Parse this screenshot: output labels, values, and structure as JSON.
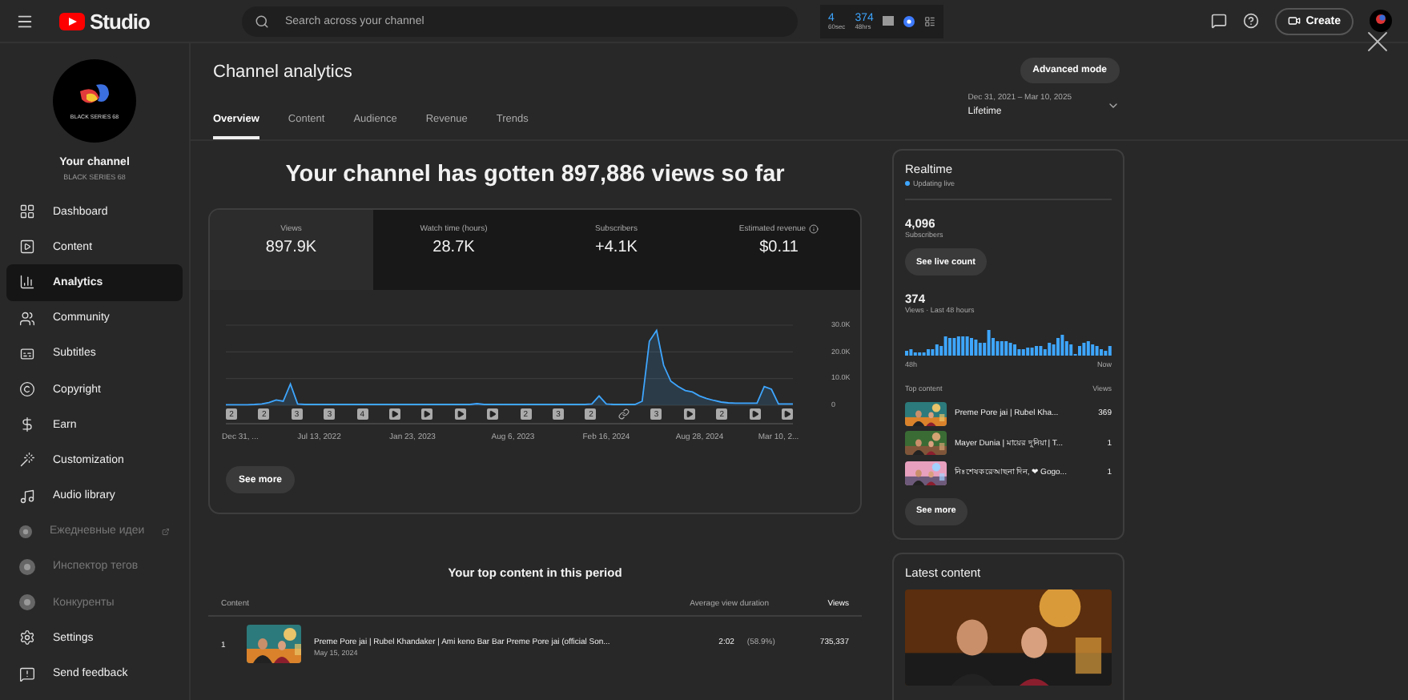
{
  "topbar": {
    "logo_text": "Studio",
    "search": {
      "placeholder": "Search across your channel"
    },
    "counters": [
      {
        "value": "4",
        "caption": "60sec"
      },
      {
        "value": "374",
        "caption": "48hrs"
      }
    ],
    "create_label": "Create"
  },
  "channel": {
    "logo_text": "BLACK SERIES 68",
    "name": "Your channel",
    "handle": "BLACK SERIES 68"
  },
  "sidebar": {
    "items": [
      {
        "kind": "dashboard",
        "label": "Dashboard",
        "selected": false,
        "disabled": false
      },
      {
        "kind": "content",
        "label": "Content",
        "selected": false,
        "disabled": false
      },
      {
        "kind": "analytics",
        "label": "Analytics",
        "selected": true,
        "disabled": false
      },
      {
        "kind": "community",
        "label": "Community",
        "selected": false,
        "disabled": false
      },
      {
        "kind": "subtitles",
        "label": "Subtitles",
        "selected": false,
        "disabled": false
      },
      {
        "kind": "copyright",
        "label": "Copyright",
        "selected": false,
        "disabled": false
      },
      {
        "kind": "earn",
        "label": "Earn",
        "selected": false,
        "disabled": false
      },
      {
        "kind": "customization",
        "label": "Customization",
        "selected": false,
        "disabled": false
      },
      {
        "kind": "audio",
        "label": "Audio library",
        "selected": false,
        "disabled": false
      },
      {
        "kind": "extension",
        "label": "Ежедневные идеи",
        "selected": false,
        "disabled": true,
        "external": true
      },
      {
        "kind": "extension",
        "label": "Инспектор тегов",
        "selected": false,
        "disabled": true,
        "external": false
      },
      {
        "kind": "extension",
        "label": "Конкуренты",
        "selected": false,
        "disabled": true,
        "external": false
      }
    ],
    "footer": [
      {
        "kind": "settings",
        "label": "Settings"
      },
      {
        "kind": "feedback",
        "label": "Send feedback"
      }
    ]
  },
  "header": {
    "title": "Channel analytics",
    "tabs": [
      {
        "label": "Overview",
        "selected": true
      },
      {
        "label": "Content",
        "selected": false
      },
      {
        "label": "Audience",
        "selected": false
      },
      {
        "label": "Revenue",
        "selected": false
      },
      {
        "label": "Trends",
        "selected": false
      }
    ],
    "advanced_button": "Advanced mode",
    "date_range": "Dec 31, 2021 – Mar 10, 2025",
    "period": "Lifetime"
  },
  "headline": "Your channel has gotten 897,886 views so far",
  "metrics": [
    {
      "label": "Views",
      "value": "897.9K",
      "selected": true,
      "info": false
    },
    {
      "label": "Watch time (hours)",
      "value": "28.7K",
      "selected": false,
      "info": false
    },
    {
      "label": "Subscribers",
      "value": "+4.1K",
      "selected": false,
      "info": false
    },
    {
      "label": "Estimated revenue",
      "value": "$0.11",
      "selected": false,
      "info": true
    }
  ],
  "chart_data": {
    "type": "area",
    "categories": [
      null,
      null,
      "Dec 31, ...",
      null,
      null,
      null,
      null,
      null,
      null,
      null,
      null,
      null,
      null,
      "Jul 13, 2022",
      null,
      null,
      null,
      null,
      null,
      null,
      null,
      null,
      null,
      null,
      null,
      null,
      "Jan 23, 2023",
      null,
      null,
      null,
      null,
      null,
      null,
      null,
      null,
      null,
      null,
      null,
      null,
      null,
      "Aug 6, 2023",
      null,
      null,
      null,
      null,
      null,
      null,
      null,
      null,
      null,
      null,
      null,
      null,
      "Feb 16, 2024",
      null,
      null,
      null,
      null,
      null,
      null,
      null,
      null,
      null,
      null,
      null,
      null,
      "Aug 28, 2024",
      null,
      null,
      null,
      null,
      null,
      null,
      null,
      null,
      null,
      null,
      "Mar 10, 2...",
      null,
      null
    ],
    "series": [
      {
        "color": "#3ea6ff",
        "values": [
          200,
          200,
          200,
          200,
          300,
          500,
          1000,
          2000,
          1500,
          8000,
          500,
          300,
          300,
          300,
          300,
          300,
          300,
          300,
          300,
          300,
          300,
          300,
          300,
          300,
          300,
          300,
          300,
          300,
          300,
          300,
          300,
          300,
          300,
          300,
          300,
          600,
          300,
          300,
          300,
          300,
          300,
          300,
          300,
          300,
          300,
          300,
          300,
          300,
          300,
          300,
          300,
          500,
          3500,
          500,
          300,
          300,
          300,
          300,
          1500,
          24000,
          28000,
          15000,
          9000,
          7000,
          5500,
          5000,
          3500,
          2500,
          1800,
          1200,
          900,
          800,
          800,
          800,
          800,
          7000,
          6000,
          500,
          500,
          500
        ]
      }
    ],
    "ylim": [
      0,
      30000
    ],
    "yticks": [
      0,
      {
        "value": 10000,
        "label": "10.0K"
      },
      {
        "value": 20000,
        "label": "20.0K"
      },
      {
        "value": 30000,
        "label": "30.0K"
      }
    ]
  },
  "markers": [
    {
      "kind": "count",
      "label": "2"
    },
    {
      "kind": "count",
      "label": "2"
    },
    {
      "kind": "count",
      "label": "3"
    },
    {
      "kind": "count",
      "label": "3"
    },
    {
      "kind": "count",
      "label": "4"
    },
    {
      "kind": "video"
    },
    {
      "kind": "video"
    },
    {
      "kind": "video"
    },
    {
      "kind": "video"
    },
    {
      "kind": "count",
      "label": "2"
    },
    {
      "kind": "count",
      "label": "3"
    },
    {
      "kind": "count",
      "label": "2"
    },
    {
      "kind": "link"
    },
    {
      "kind": "count",
      "label": "3"
    },
    {
      "kind": "video"
    },
    {
      "kind": "count",
      "label": "2"
    },
    {
      "kind": "video"
    },
    {
      "kind": "video"
    }
  ],
  "see_more": "See more",
  "top_content": {
    "title": "Your top content in this period",
    "columns": [
      "Content",
      "Average view duration",
      "Views"
    ],
    "rows": [
      {
        "rank": "1",
        "title": "Preme Pore jai | Rubel Khandaker | Ami keno Bar Bar Preme Pore jai (official Son...",
        "date": "May 15, 2024",
        "duration": "2:02",
        "percent": "(58.9%)",
        "views": "735,337"
      }
    ]
  },
  "realtime": {
    "title": "Realtime",
    "status": "Updating live",
    "subscribers": "4,096",
    "subscribers_label": "Subscribers",
    "live_button": "See live count",
    "views": "374",
    "views_label": "Views · Last 48 hours",
    "axis_start": "48h",
    "axis_end": "Now",
    "list_label": "Top content",
    "list_views_label": "Views",
    "items": [
      {
        "title": "Preme Pore jai | Rubel Kha...",
        "views": "369"
      },
      {
        "title": "Mayer Dunia | মায়ের দুনিয়া | T...",
        "views": "1"
      },
      {
        "title": "নিঃশেষকরেআছনা দিন, ❤ Gogo...",
        "views": "1"
      }
    ],
    "see_more": "See more"
  },
  "latest": {
    "title": "Latest content"
  }
}
